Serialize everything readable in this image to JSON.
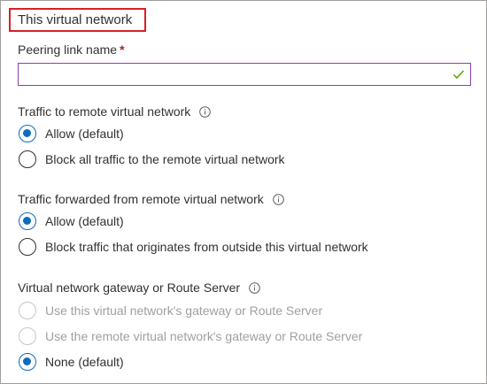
{
  "section": {
    "title": "This virtual network"
  },
  "peering": {
    "label": "Peering link name",
    "required_marker": "*",
    "value": "",
    "valid_icon": "checkmark-icon"
  },
  "traffic_to_remote": {
    "label": "Traffic to remote virtual network",
    "info_icon": "info-icon",
    "options": [
      {
        "label": "Allow (default)",
        "checked": true,
        "disabled": false
      },
      {
        "label": "Block all traffic to the remote virtual network",
        "checked": false,
        "disabled": false
      }
    ]
  },
  "traffic_forwarded": {
    "label": "Traffic forwarded from remote virtual network",
    "info_icon": "info-icon",
    "options": [
      {
        "label": "Allow (default)",
        "checked": true,
        "disabled": false
      },
      {
        "label": "Block traffic that originates from outside this virtual network",
        "checked": false,
        "disabled": false
      }
    ]
  },
  "gateway": {
    "label": "Virtual network gateway or Route Server",
    "info_icon": "info-icon",
    "options": [
      {
        "label": "Use this virtual network's gateway or Route Server",
        "checked": false,
        "disabled": true
      },
      {
        "label": "Use the remote virtual network's gateway or Route Server",
        "checked": false,
        "disabled": true
      },
      {
        "label": "None (default)",
        "checked": true,
        "disabled": false
      }
    ]
  },
  "colors": {
    "accent": "#0f6cbd",
    "highlight_border": "#d81f26",
    "input_border": "#8a3fae",
    "valid_check": "#57a300",
    "disabled_text": "#a19f9d"
  }
}
